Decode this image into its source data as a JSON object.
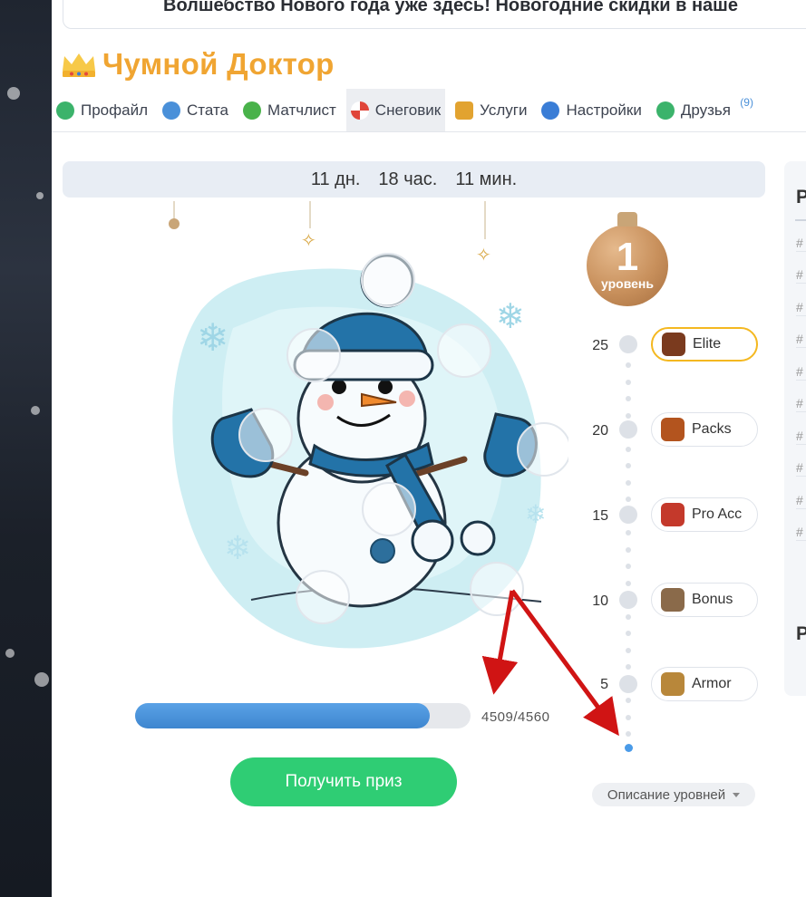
{
  "banner": {
    "text": "Волшебство Нового года уже здесь! Новогодние скидки в наше"
  },
  "profile": {
    "name": "Чумной Доктор"
  },
  "tabs": [
    {
      "label": "Профайл",
      "icon": "paw-icon",
      "color": "#3bb36b"
    },
    {
      "label": "Стата",
      "icon": "info-icon",
      "color": "#4a90d9"
    },
    {
      "label": "Матчлист",
      "icon": "radiation-icon",
      "color": "#49b24a"
    },
    {
      "label": "Снеговик",
      "icon": "candy-icon",
      "color": "#e0453a"
    },
    {
      "label": "Услуги",
      "icon": "box-icon",
      "color": "#e2a330"
    },
    {
      "label": "Настройки",
      "icon": "gear-icon",
      "color": "#3a7dd6"
    },
    {
      "label": "Друзья",
      "icon": "friends-icon",
      "color": "#3bb36b",
      "badge": "(9)"
    }
  ],
  "timer": {
    "days": "11 дн.",
    "hours": "18 час.",
    "minutes": "11 мин."
  },
  "level": {
    "number": "1",
    "label": "уровень"
  },
  "progress": {
    "current": 4509,
    "total": 4560,
    "text": "4509/4560",
    "fraction": 0.878
  },
  "prize_button": "Получить приз",
  "level_rewards": [
    {
      "level": "25",
      "name": "Elite",
      "highlight": true,
      "icon_color": "#7a3a1e"
    },
    {
      "level": "20",
      "name": "Packs",
      "highlight": false,
      "icon_color": "#b3541e"
    },
    {
      "level": "15",
      "name": "Pro Acc",
      "highlight": false,
      "icon_color": "#c4392b"
    },
    {
      "level": "10",
      "name": "Bonus",
      "highlight": false,
      "icon_color": "#8a6a4a"
    },
    {
      "level": "5",
      "name": "Armor",
      "highlight": false,
      "icon_color": "#b8873a"
    }
  ],
  "levels_description": "Описание уровней",
  "right_panel": {
    "header": "P",
    "header2": "P",
    "rows": [
      "#",
      "#",
      "#",
      "#",
      "#",
      "#",
      "#",
      "#",
      "#",
      "#"
    ]
  },
  "colors": {
    "accent_orange": "#f0a532",
    "green": "#2fcd74",
    "blue": "#3e86cf",
    "arrow_red": "#d01414"
  }
}
